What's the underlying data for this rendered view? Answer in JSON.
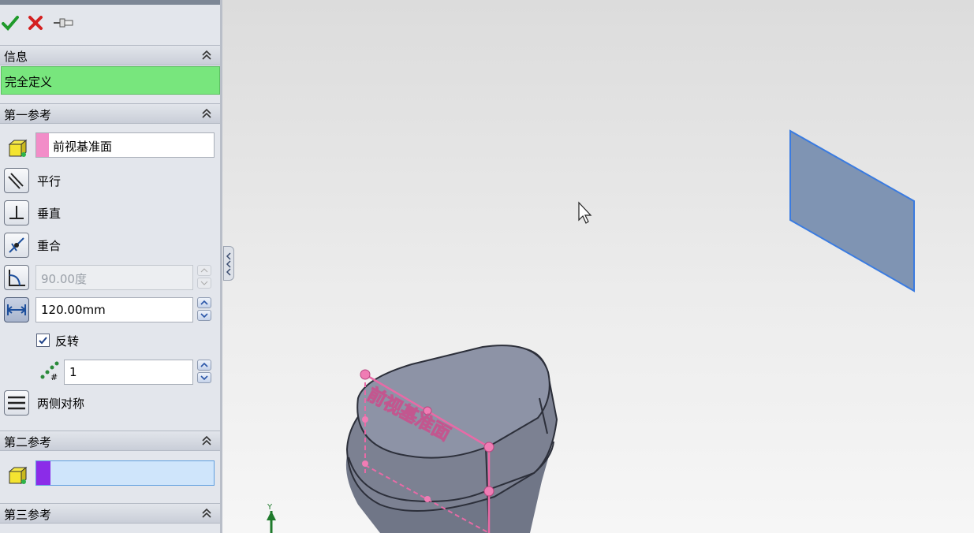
{
  "panel": {
    "toolbar": {
      "ok_icon": "check-icon",
      "cancel_icon": "close-icon",
      "pin_icon": "pushpin-icon"
    },
    "info_section": {
      "title": "信息",
      "status_text": "完全定义",
      "status_color": "#78e67d"
    },
    "first_reference": {
      "title": "第一参考",
      "selection": "前视基准面",
      "selection_color": "#f28dc8",
      "options": [
        {
          "label": "平行",
          "icon": "parallel-icon"
        },
        {
          "label": "垂直",
          "icon": "perpendicular-icon"
        },
        {
          "label": "重合",
          "icon": "coincident-icon"
        }
      ],
      "angle_value": "90.00度",
      "distance_value": "120.00mm",
      "flip_label": "反转",
      "flip_checked": true,
      "instances_value": "1",
      "mid_plane_label": "两侧对称"
    },
    "second_reference": {
      "title": "第二参考",
      "selection": "",
      "selection_color": "#8b2ce8"
    },
    "third_reference": {
      "title": "第三参考"
    }
  },
  "viewport": {
    "plane_label": "前视基准面",
    "axis_label": "Y",
    "accent": "#3a7be0"
  }
}
